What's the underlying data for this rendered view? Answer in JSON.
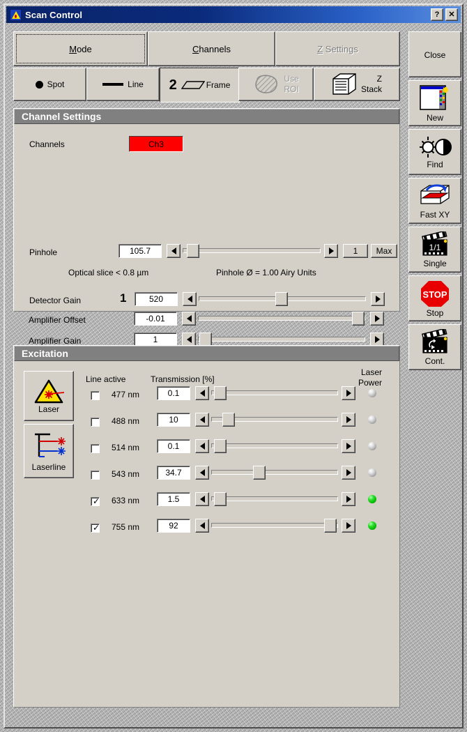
{
  "window": {
    "title": "Scan Control",
    "icon": "scan-control-icon",
    "help_label": "?",
    "close_label": "✕"
  },
  "tabs": [
    {
      "label": "Mode",
      "accel": "M",
      "state": "focused"
    },
    {
      "label": "Channels",
      "accel": "C",
      "state": "selected"
    },
    {
      "label": "Z Settings",
      "accel": "Z",
      "state": "disabled"
    }
  ],
  "mode_buttons": [
    {
      "label": "Spot",
      "icon": "spot-icon",
      "state": "normal"
    },
    {
      "label": "Line",
      "icon": "line-icon",
      "state": "normal"
    },
    {
      "label": "Frame",
      "icon": "frame-icon",
      "badge": "2",
      "state": "pressed"
    },
    {
      "label": "Use\nROI",
      "label1": "Use",
      "label2": "ROI",
      "icon": "roi-icon",
      "state": "disabled"
    },
    {
      "label": "Z Stack",
      "label1": "Z",
      "label2": "Stack",
      "icon": "z-stack-icon",
      "state": "normal"
    }
  ],
  "channel_settings": {
    "title": "Channel Settings",
    "channels_label": "Channels",
    "channel_button": {
      "label": "Ch3",
      "color": "#ff0000"
    },
    "pinhole": {
      "label": "Pinhole",
      "value": "105.7",
      "slider_percent": 3,
      "unit_button": "1",
      "max_button": "Max"
    },
    "optical_slice_text": "Optical slice < 0.8 µm",
    "pinhole_diameter_text": "Pinhole Ø = 1.00 Airy Units",
    "detector_gain": {
      "label": "Detector Gain",
      "marker": "1",
      "value": "520",
      "slider_percent": 48
    },
    "amplifier_offset": {
      "label": "Amplifier Offset",
      "value": "-0.01",
      "slider_percent": 95
    },
    "amplifier_gain": {
      "label": "Amplifier Gain",
      "value": "1",
      "slider_percent": 2
    }
  },
  "excitation": {
    "title": "Excitation",
    "side_buttons": [
      {
        "label": "Laser",
        "icon": "laser-warning-icon"
      },
      {
        "label": "Laserline",
        "icon": "laserline-icon"
      }
    ],
    "headers": {
      "line_active": "Line active",
      "transmission": "Transmission [%]",
      "laser_power_1": "Laser",
      "laser_power_2": "Power"
    },
    "lines": [
      {
        "wavelength": "477 nm",
        "active": false,
        "value": "0.1",
        "slider_percent": 3,
        "power_on": false
      },
      {
        "wavelength": "488 nm",
        "active": false,
        "value": "10",
        "slider_percent": 10,
        "power_on": false
      },
      {
        "wavelength": "514 nm",
        "active": false,
        "value": "0.1",
        "slider_percent": 3,
        "power_on": false
      },
      {
        "wavelength": "543 nm",
        "active": false,
        "value": "34.7",
        "slider_percent": 35,
        "power_on": false
      },
      {
        "wavelength": "633 nm",
        "active": true,
        "value": "1.5",
        "slider_percent": 3,
        "power_on": true
      },
      {
        "wavelength": "755 nm",
        "active": true,
        "value": "92",
        "slider_percent": 92,
        "power_on": true
      }
    ]
  },
  "toolbar": [
    {
      "label": "Close",
      "icon": "none"
    },
    {
      "label": "New",
      "icon": "new-image-icon"
    },
    {
      "label": "Find",
      "icon": "find-brightness-contrast-icon"
    },
    {
      "label": "Fast XY",
      "icon": "fast-xy-icon"
    },
    {
      "label": "Single",
      "icon": "single-scan-icon"
    },
    {
      "label": "Stop",
      "icon": "stop-sign-icon",
      "icon_text": "STOP"
    },
    {
      "label": "Cont.",
      "icon": "continuous-scan-icon"
    }
  ]
}
